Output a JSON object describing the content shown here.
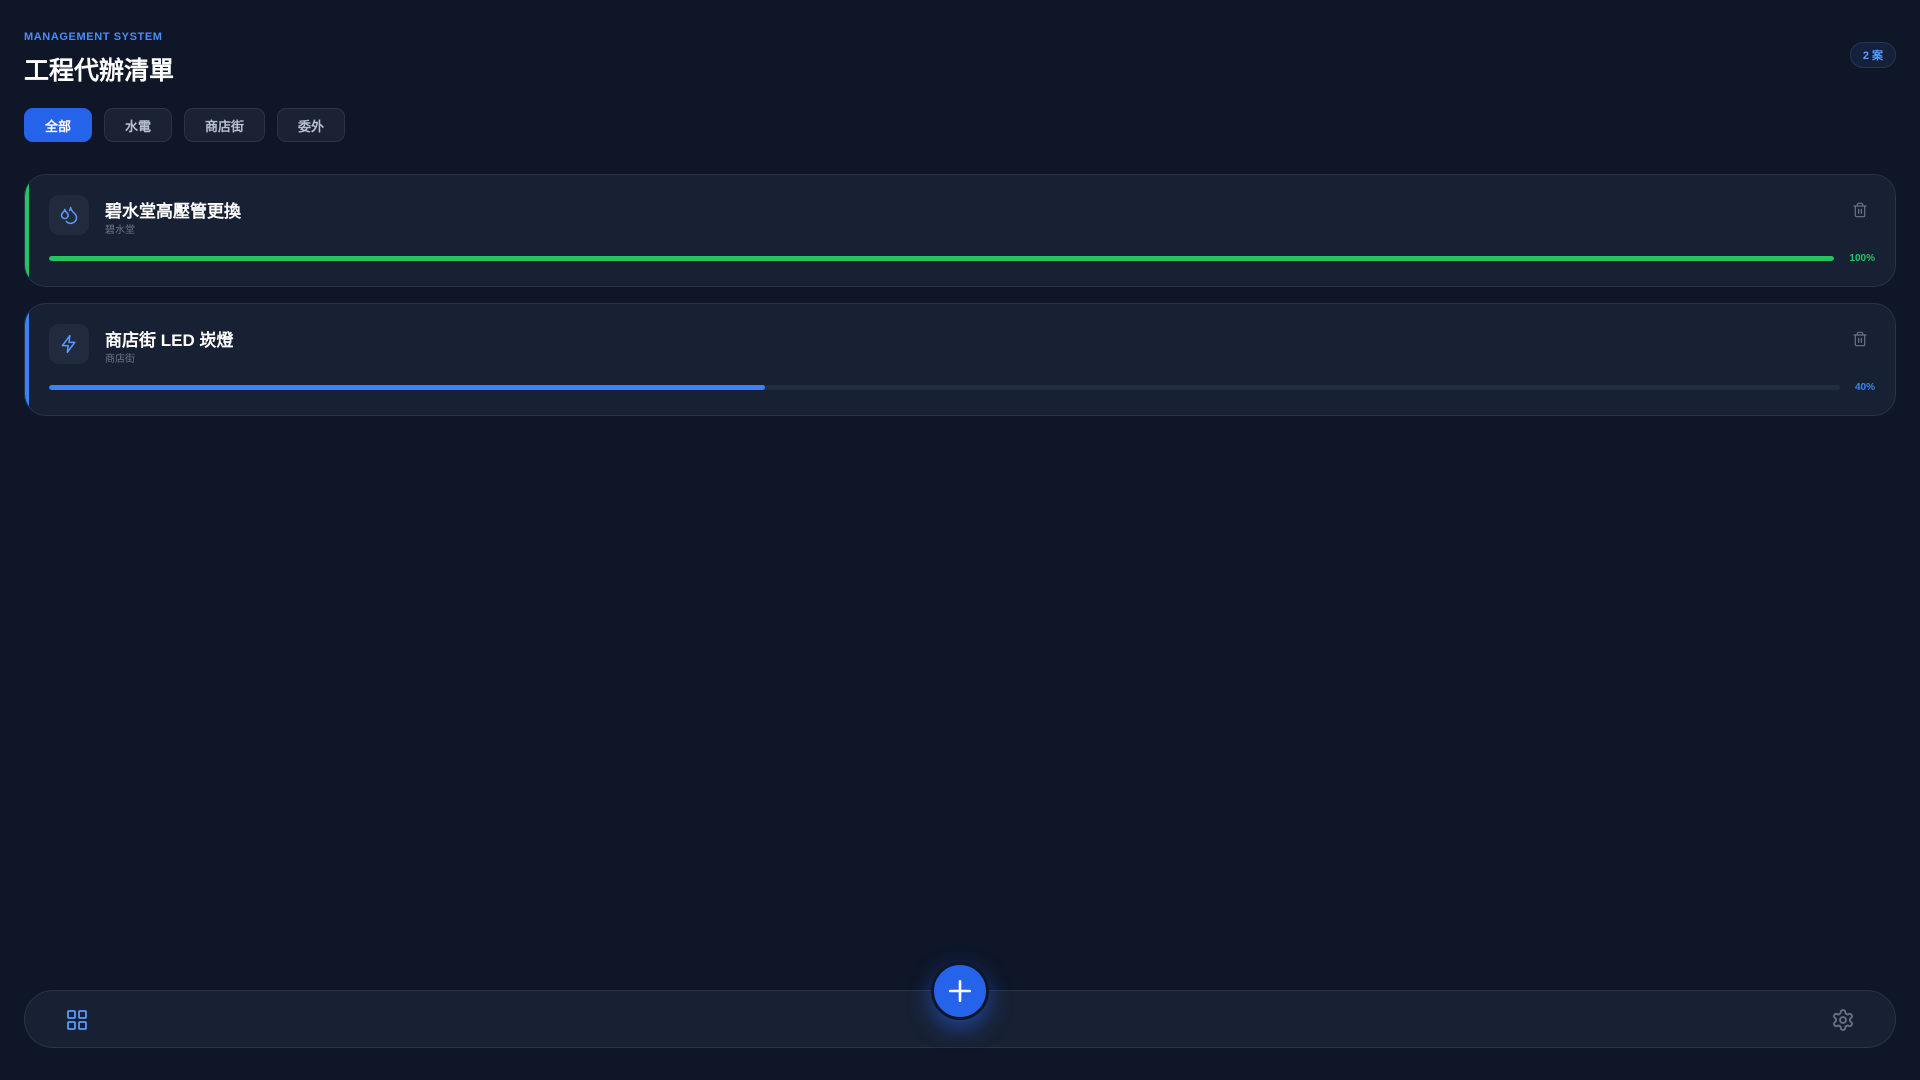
{
  "header": {
    "eyebrow": "MANAGEMENT SYSTEM",
    "title": "工程代辦清單",
    "count_badge": "2 案"
  },
  "filters": [
    {
      "label": "全部",
      "active": true
    },
    {
      "label": "水電",
      "active": false
    },
    {
      "label": "商店街",
      "active": false
    },
    {
      "label": "委外",
      "active": false
    }
  ],
  "projects": [
    {
      "title": "碧水堂高壓管更換",
      "subtitle": "碧水堂",
      "icon": "droplets-icon",
      "progress": 100,
      "progress_label": "100%",
      "accent": "#22c55e"
    },
    {
      "title": "商店街 LED 崁燈",
      "subtitle": "商店街",
      "icon": "lightning-icon",
      "progress": 40,
      "progress_label": "40%",
      "accent": "#3b82f6"
    }
  ],
  "bottom_nav": {
    "left_icon": "grid-icon",
    "center_icon": "plus-icon",
    "right_icon": "gear-icon"
  },
  "colors": {
    "background": "#0e1628",
    "primary": "#2563eb",
    "eyebrow": "#4c8df5"
  }
}
